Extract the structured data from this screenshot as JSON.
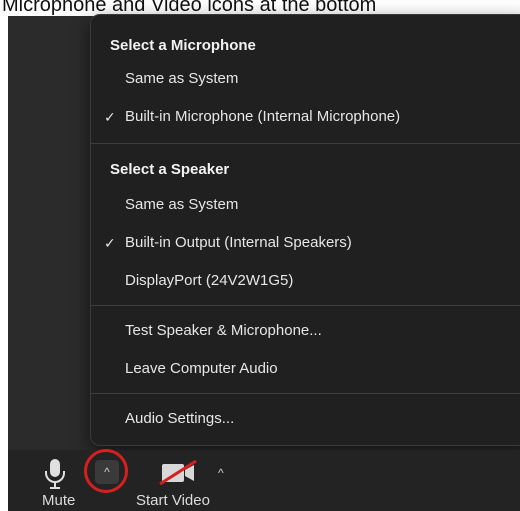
{
  "caption": "Microphone and Video icons at the bottom",
  "audio_menu": {
    "microphone_section": {
      "header": "Select a Microphone",
      "items": [
        {
          "label": "Same as System",
          "checked": false
        },
        {
          "label": "Built-in Microphone (Internal Microphone)",
          "checked": true
        }
      ]
    },
    "speaker_section": {
      "header": "Select a Speaker",
      "items": [
        {
          "label": "Same as System",
          "checked": false
        },
        {
          "label": "Built-in Output (Internal Speakers)",
          "checked": true
        },
        {
          "label": "DisplayPort (24V2W1G5)",
          "checked": false
        }
      ]
    },
    "actions": [
      {
        "label": "Test Speaker & Microphone..."
      },
      {
        "label": "Leave Computer Audio"
      }
    ],
    "settings": {
      "label": "Audio Settings..."
    },
    "check_glyph": "✓"
  },
  "toolbar": {
    "mute_label": "Mute",
    "start_video_label": "Start Video",
    "caret_glyph": "^"
  },
  "colors": {
    "highlight_ring": "#d61f1f",
    "menu_bg": "#202020"
  }
}
